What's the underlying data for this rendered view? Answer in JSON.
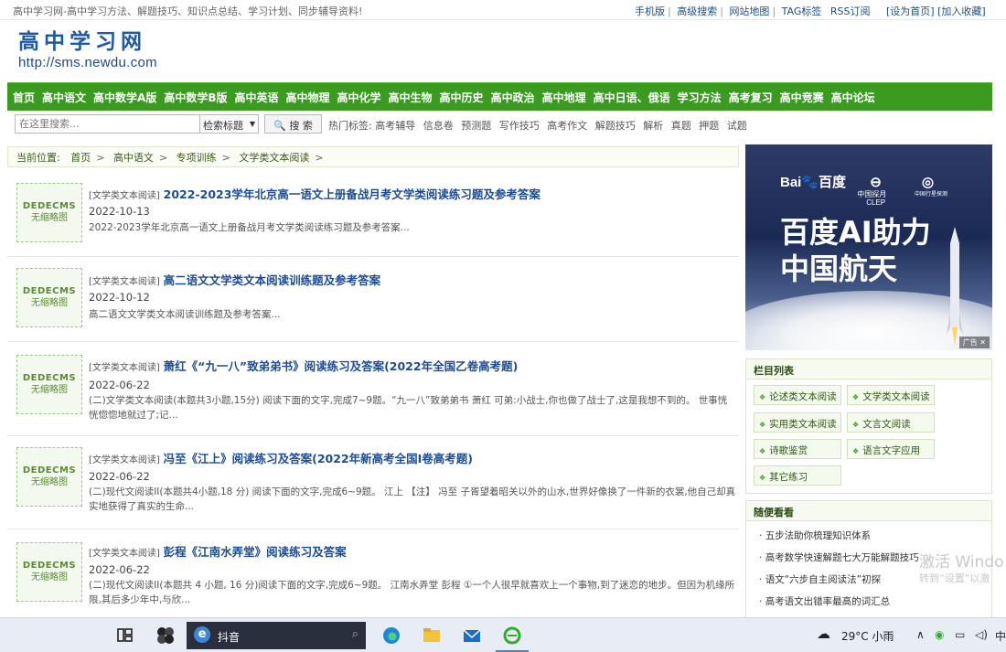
{
  "topbar": {
    "intro": "高中学习网-高中学习方法、解题技巧、知识点总结、学习计划、同步辅导资料!",
    "links": [
      "手机版",
      "高级搜索",
      "网站地图",
      "TAG标签",
      "RSS订阅"
    ],
    "actions": [
      "[设为首页]",
      "[加入收藏]"
    ]
  },
  "logo": {
    "name": "高中学习网",
    "url": "http://sms.newdu.com"
  },
  "nav": [
    "首页",
    "高中语文",
    "高中数学A版",
    "高中数学B版",
    "高中英语",
    "高中物理",
    "高中化学",
    "高中生物",
    "高中历史",
    "高中政治",
    "高中地理",
    "高中日语、俄语",
    "学习方法",
    "高考复习",
    "高中竞赛",
    "高中论坛"
  ],
  "search": {
    "placeholder": "在这里搜索...",
    "select_value": "检索标题",
    "button": "搜 索",
    "hot_label": "热门标签:",
    "hot_tags": [
      "高考辅导",
      "信息卷",
      "预测题",
      "写作技巧",
      "高考作文",
      "解题技巧",
      "解析",
      "真题",
      "押题",
      "试题"
    ]
  },
  "breadcrumb": [
    "当前位置:",
    "首页",
    "高中语文",
    "专项训练",
    "文学类文本阅读"
  ],
  "thumb": {
    "line1": "DEDECMS",
    "line2": "无缩略图"
  },
  "articles": [
    {
      "category": "[文学类文本阅读]",
      "title": "2022-2023学年北京高一语文上册备战月考文学类阅读练习题及参考答案",
      "date": "2022-10-13",
      "desc": "2022-2023学年北京高一语文上册备战月考文学类阅读练习题及参考答案..."
    },
    {
      "category": "[文学类文本阅读]",
      "title": "高二语文文学类文本阅读训练题及参考答案",
      "date": "2022-10-12",
      "desc": "高二语文文学类文本阅读训练题及参考答案..."
    },
    {
      "category": "[文学类文本阅读]",
      "title": "萧红《“九一八”致弟弟书》阅读练习及答案(2022年全国乙卷高考题)",
      "date": "2022-06-22",
      "desc": "(二)文学类文本阅读(本题共3小题,15分) 阅读下面的文字,完成7~9题。“九一八”致弟弟书 萧红 可弟:小战士,你也做了战士了,这是我想不到的。 世事恍恍惚惚地就过了;记..."
    },
    {
      "category": "[文学类文本阅读]",
      "title": "冯至《江上》阅读练习及答案(2022年新高考全国I卷高考题)",
      "date": "2022-06-22",
      "desc": "(二)现代文阅读II(本题共4小题,18 分) 阅读下面的文字,完成6~9题。 江上 【注】 冯至 子胥望着昭关以外的山水,世界好像换了一件新的衣裳,他自己却真实地获得了真实的生命..."
    },
    {
      "category": "[文学类文本阅读]",
      "title": "彭程《江南水弄堂》阅读练习及答案",
      "date": "2022-06-22",
      "desc": "(二)现代文阅读II(本题共 4 小题, 16 分)阅读下面的文字,完成6~9题。 江南水弄堂 彭程 ①一个人很早就喜欢上一个事物,到了迷恋的地步。但因为机缘所限,其后多少年中,与欣..."
    }
  ],
  "ad": {
    "brand1": "Bai",
    "brand1b": "百度",
    "brand2": "中国探月",
    "brand2b": "CLEP",
    "brand3": "中国行星探测",
    "headline1": "百度AI助力",
    "headline2": "中国航天",
    "tag": "广告"
  },
  "sidebar": {
    "columns_title": "栏目列表",
    "columns": [
      "论述类文本阅读",
      "文学类文本阅读",
      "实用类文本阅读",
      "文言文阅读",
      "诗歌鉴赏",
      "语言文字应用",
      "其它练习"
    ],
    "random_title": "随便看看",
    "random": [
      "五步法助你梳理知识体系",
      "高考数学快速解题七大万能解题技巧",
      "语文“六步自主阅读法”初探",
      "高考语文出错率最高的词汇总"
    ]
  },
  "watermark": {
    "line1": "激活 Windo",
    "line2": "转到“设置”以激"
  },
  "taskbar": {
    "search_text": "抖音",
    "weather": "29°C 小雨",
    "ime": "中"
  }
}
